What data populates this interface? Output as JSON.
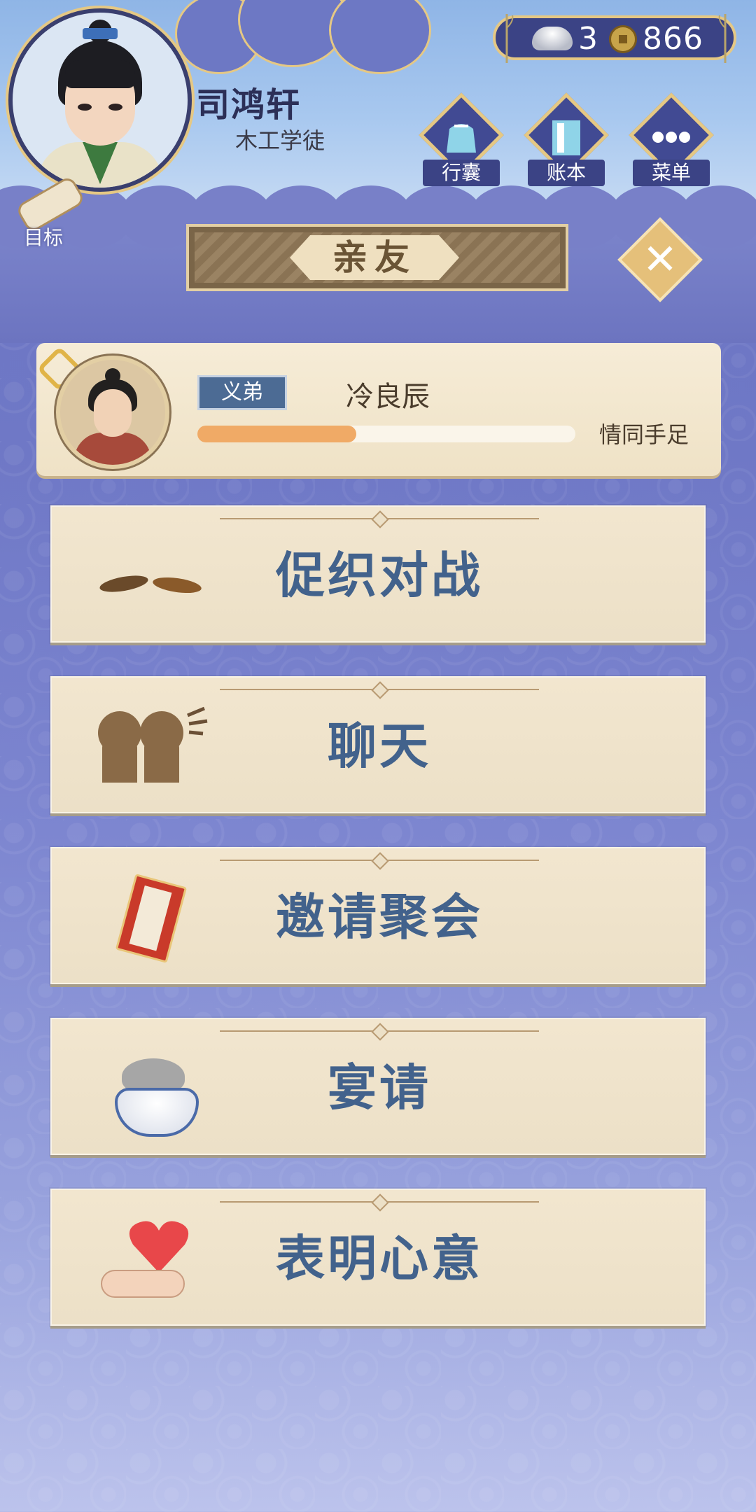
{
  "player": {
    "name": "司鸿轩",
    "title": "木工学徒"
  },
  "currency": {
    "silver": "3",
    "coins": "866"
  },
  "menu": [
    {
      "label": "行囊",
      "icon": "bag-icon"
    },
    {
      "label": "账本",
      "icon": "ledger-icon"
    },
    {
      "label": "菜单",
      "icon": "more-icon"
    }
  ],
  "goal": {
    "label": "目标"
  },
  "section": {
    "title": "亲友"
  },
  "friend": {
    "relation": "义弟",
    "name": "冷良辰",
    "bond_label": "情同手足",
    "bond_progress": 0.42
  },
  "actions": [
    {
      "label": "促织对战",
      "icon": "cricket-icon"
    },
    {
      "label": "聊天",
      "icon": "chat-icon"
    },
    {
      "label": "邀请聚会",
      "icon": "invitation-icon"
    },
    {
      "label": "宴请",
      "icon": "feast-icon"
    },
    {
      "label": "表明心意",
      "icon": "heart-icon"
    }
  ],
  "colors": {
    "accent": "#42628c",
    "gold": "#e5c884",
    "navy": "#3b4385"
  }
}
